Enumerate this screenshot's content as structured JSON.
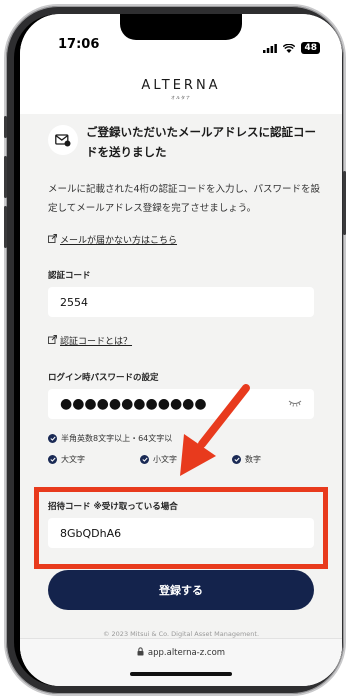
{
  "status": {
    "time": "17:06",
    "battery": "48"
  },
  "header": {
    "logo": "ALTERNA",
    "logo_sub": "オルタナ"
  },
  "title": "ご登録いただいたメールアドレスに認証コードを送りました",
  "description": "メールに記載された4桁の認証コードを入力し、パスワードを設定してメールアドレス登録を完了させましょう。",
  "links": {
    "mail_not_received": "メールが届かない方はこちら",
    "what_is_code": "認証コードとは？"
  },
  "auth_code": {
    "label": "認証コード",
    "value": "2554"
  },
  "password": {
    "label": "ログイン時パスワードの設定",
    "value": "●●●●●●●●●●●●"
  },
  "rules": {
    "length": "半角英数8文字以上・64文字以",
    "upper": "大文字",
    "lower": "小文字",
    "digit": "数字"
  },
  "invite": {
    "label": "招待コード ※受け取っている場合",
    "value": "8GbQDhA6"
  },
  "register_button": "登録する",
  "copyright": "© 2023 Mitsui & Co. Digital Asset Management.",
  "url": "app.alterna-z.com",
  "colors": {
    "navy": "#14234c",
    "highlight": "#e83a1d"
  }
}
